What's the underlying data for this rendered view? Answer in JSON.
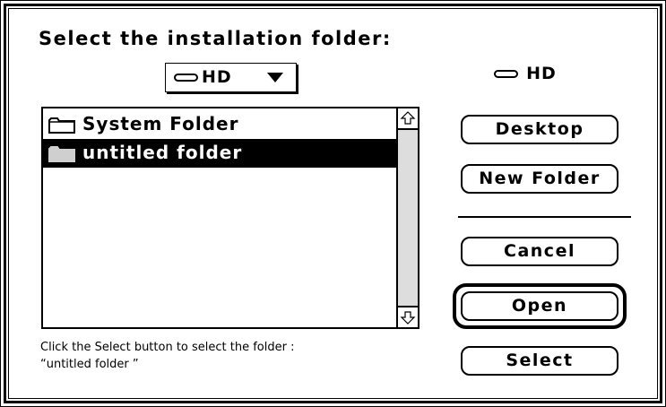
{
  "dialog": {
    "prompt": "Select the installation folder:",
    "volume_popup": {
      "selected": "HD"
    },
    "current_volume": "HD",
    "file_list": {
      "items": [
        {
          "name": "System Folder",
          "icon": "folder-icon",
          "selected": false
        },
        {
          "name": "untitled folder",
          "icon": "folder-icon",
          "selected": true
        }
      ]
    },
    "hint": {
      "line1": "Click the Select button to select the folder :",
      "line2": "“untitled folder ”"
    },
    "buttons": {
      "desktop": "Desktop",
      "new_folder": "New Folder",
      "cancel": "Cancel",
      "open": "Open",
      "select": "Select"
    },
    "default_button": "open"
  }
}
